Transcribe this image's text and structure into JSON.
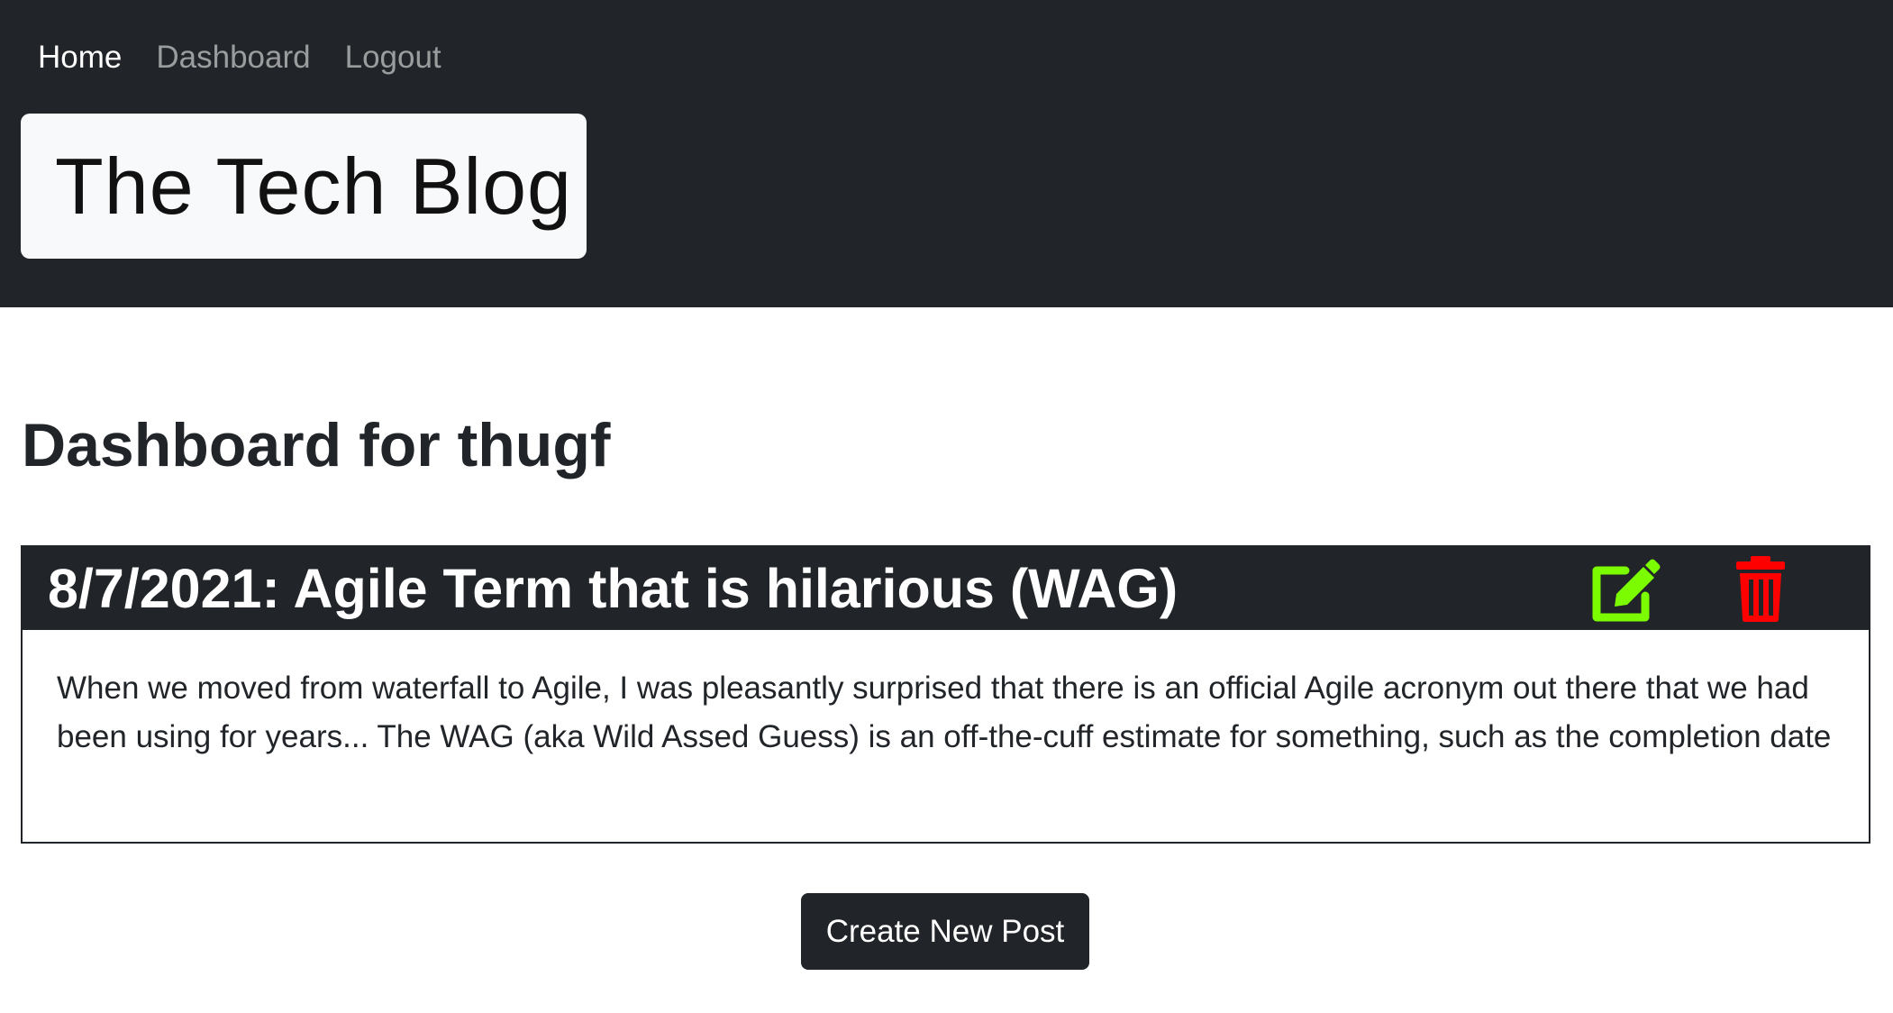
{
  "nav": {
    "items": [
      {
        "label": "Home"
      },
      {
        "label": "Dashboard"
      },
      {
        "label": "Logout"
      }
    ]
  },
  "brand": {
    "title": "The Tech Blog"
  },
  "dashboard": {
    "title": "Dashboard for thugf"
  },
  "posts": [
    {
      "title": "8/7/2021: Agile Term that is hilarious (WAG)",
      "body": "When we moved from waterfall to Agile, I was pleasantly surprised that there is an official Agile acronym out there that we had been using for years... The WAG (aka Wild Assed Guess) is an off-the-cuff estimate for something, such as the completion date",
      "edit_icon": "edit-icon",
      "delete_icon": "trash-icon"
    }
  ],
  "actions": {
    "create_label": "Create New Post"
  },
  "colors": {
    "header_bg": "#212529",
    "brand_box_bg": "#f8f9fa",
    "edit_icon": "#7CFC00",
    "delete_icon": "#FF0000"
  }
}
